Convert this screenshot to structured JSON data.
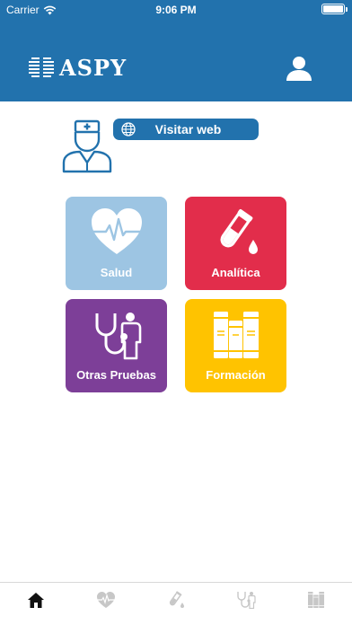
{
  "status_bar": {
    "carrier": "Carrier",
    "time": "9:06 PM"
  },
  "header": {
    "logo_text": "ASPY",
    "logo_icon": "aspy-logo-mark",
    "user_icon": "user-icon"
  },
  "visit_button": {
    "label": "Visitar web",
    "icon": "globe-icon"
  },
  "tiles": [
    {
      "label": "Salud",
      "icon": "heart-pulse-icon",
      "color": "#9dc5e3"
    },
    {
      "label": "Analítica",
      "icon": "test-tube-icon",
      "color": "#e22d4b"
    },
    {
      "label": "Otras Pruebas",
      "icon": "stethoscope-icon",
      "color": "#7d3f98"
    },
    {
      "label": "Formación",
      "icon": "books-icon",
      "color": "#ffc300"
    }
  ],
  "tabbar": {
    "tabs": [
      "home-icon",
      "heart-pulse-icon",
      "test-tube-icon",
      "stethoscope-icon",
      "books-icon"
    ],
    "active_color": "#111111",
    "inactive_color": "#c7c7c7"
  },
  "colors": {
    "header": "#2272ad",
    "doctor_icon": "#2272ad"
  }
}
